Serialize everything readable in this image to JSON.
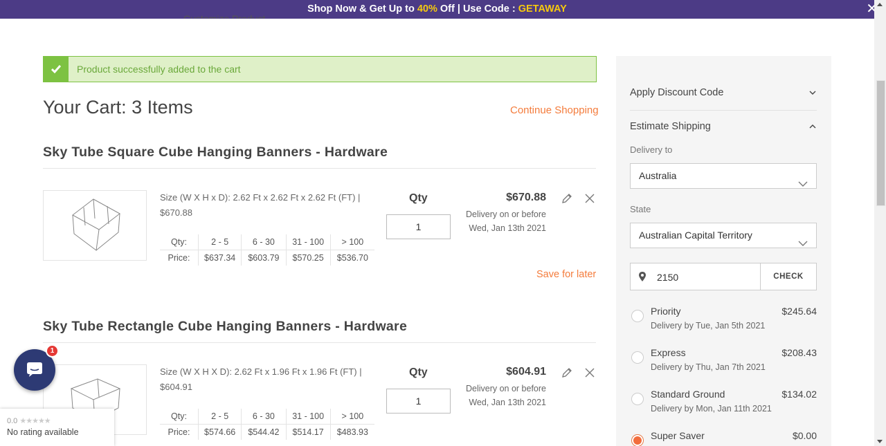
{
  "promo": {
    "prefix": "Shop Now & Get Up to ",
    "percent": "40%",
    "middle": " Off | Use Code : ",
    "code": "GETAWAY",
    "close": "✕"
  },
  "header_cut_text": "Customize Product",
  "alert": {
    "message": "Product successfully added to the cart"
  },
  "cart": {
    "title": "Your Cart: 3 Items",
    "continue_label": "Continue Shopping",
    "qty_label": "Qty",
    "tier_row_labels": [
      "Qty:",
      "Price:"
    ],
    "items": [
      {
        "title": "Sky Tube Square Cube Hanging Banners - Hardware",
        "size": "Size (W X H x D): 2.62 Ft x 2.62 Ft x 2.62 Ft (FT) | $670.88",
        "tiers_qty": [
          "2 - 5",
          "6 - 30",
          "31 - 100",
          "> 100"
        ],
        "tiers_price": [
          "$637.34",
          "$603.79",
          "$570.25",
          "$536.70"
        ],
        "qty": "1",
        "price": "$670.88",
        "delivery_line1": "Delivery on or before",
        "delivery_line2": "Wed, Jan 13th 2021",
        "save_label": "Save for later"
      },
      {
        "title": "Sky Tube Rectangle Cube Hanging Banners - Hardware",
        "size": "Size (W X H X D): 2.62 Ft x 1.96 Ft x 1.96 Ft (FT) | $604.91",
        "tiers_qty": [
          "2 - 5",
          "6 - 30",
          "31 - 100",
          "> 100"
        ],
        "tiers_price": [
          "$574.66",
          "$544.42",
          "$514.17",
          "$483.93"
        ],
        "qty": "1",
        "price": "$604.91",
        "delivery_line1": "Delivery on or before",
        "delivery_line2": "Wed, Jan 13th 2021"
      }
    ]
  },
  "sidebar": {
    "discount_label": "Apply Discount Code",
    "shipping_label": "Estimate Shipping",
    "delivery_to_label": "Delivery to",
    "country": "Australia",
    "state_label": "State",
    "state": "Australian Capital Territory",
    "zip": "2150",
    "check_label": "CHECK",
    "options": [
      {
        "name": "Priority",
        "cost": "$245.64",
        "by": "Delivery by Tue, Jan 5th 2021",
        "selected": false
      },
      {
        "name": "Express",
        "cost": "$208.43",
        "by": "Delivery by Thu, Jan 7th 2021",
        "selected": false
      },
      {
        "name": "Standard Ground",
        "cost": "$134.02",
        "by": "Delivery by Mon, Jan 11th 2021",
        "selected": false
      },
      {
        "name": "Super Saver",
        "cost": "$0.00",
        "by": "",
        "selected": true
      }
    ]
  },
  "chat": {
    "badge": "1"
  },
  "rating": {
    "score": "0.0",
    "stars": "★★★★★",
    "text": "No rating available"
  },
  "colors": {
    "promo_bg": "#4c3b86",
    "promo_highlight": "#f6c90e",
    "accent": "#f47c3c",
    "success": "#7dc242",
    "chat_bg": "#2d3a74"
  }
}
